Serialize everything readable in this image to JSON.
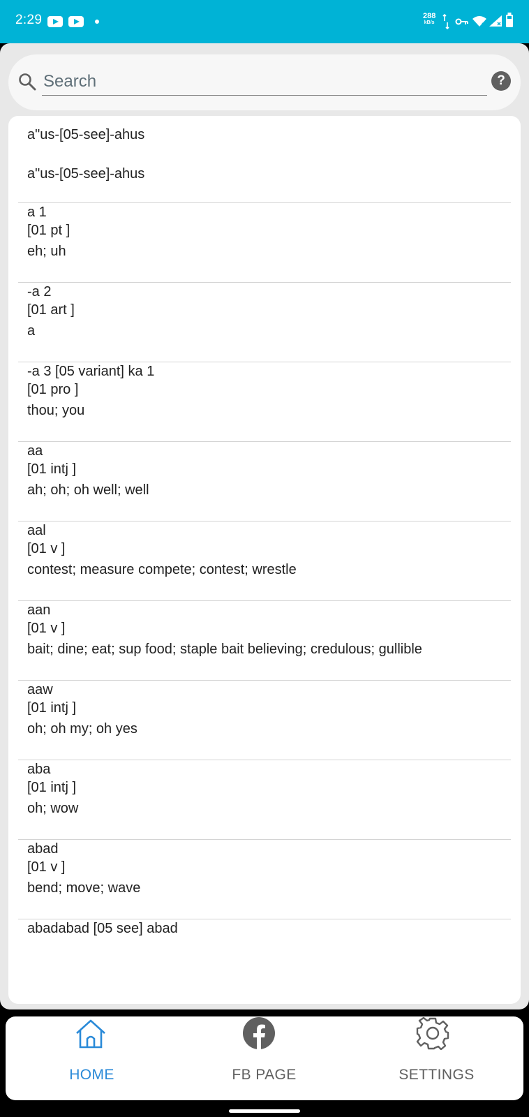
{
  "status_bar": {
    "time": "2:29",
    "net_speed_value": "288",
    "net_speed_unit": "kB/s",
    "bg_color": "#00b3d6",
    "icons": [
      "youtube-icon",
      "youtube-icon",
      "notification-dot",
      "data-activity-icon",
      "vpn-key-icon",
      "wifi-icon",
      "cell-signal-icon",
      "battery-icon"
    ]
  },
  "search": {
    "placeholder": "Search",
    "value": ""
  },
  "entries": [
    {
      "lines": [
        "a\"us-[05-see]-ahus",
        "a\"us-[05-see]-ahus"
      ]
    },
    {
      "lines": [
        "a 1",
        "[01 pt ]",
        "eh; uh"
      ]
    },
    {
      "lines": [
        "-a 2",
        "[01 art ]",
        "a"
      ]
    },
    {
      "lines": [
        "-a 3 [05 variant] ka 1",
        "[01 pro ]",
        "thou; you"
      ]
    },
    {
      "lines": [
        "aa",
        "[01 intj ]",
        "ah; oh; oh well; well"
      ]
    },
    {
      "lines": [
        "aal",
        "[01 v ]",
        "contest; measure compete; contest; wrestle"
      ]
    },
    {
      "lines": [
        "aan",
        "[01 v ]",
        "bait; dine; eat; sup food; staple bait believing; credulous; gullible"
      ]
    },
    {
      "lines": [
        "aaw",
        "[01 intj ]",
        "oh; oh my; oh yes"
      ]
    },
    {
      "lines": [
        "aba",
        "[01 intj ]",
        "oh; wow"
      ]
    },
    {
      "lines": [
        "abad",
        "[01 v ]",
        "bend; move; wave"
      ]
    },
    {
      "lines": [
        "abadabad [05 see] abad"
      ]
    }
  ],
  "bottom_nav": {
    "items": [
      {
        "label": "HOME",
        "icon": "home-icon",
        "active": true
      },
      {
        "label": "FB PAGE",
        "icon": "facebook-icon",
        "active": false
      },
      {
        "label": "SETTINGS",
        "icon": "gear-icon",
        "active": false
      }
    ],
    "active_color": "#2a8ad8",
    "inactive_color": "#606060"
  }
}
